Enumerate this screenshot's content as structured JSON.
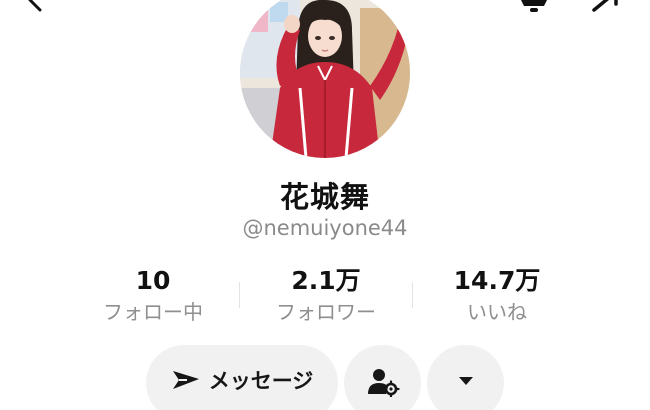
{
  "profile": {
    "display_name": "花城舞",
    "handle": "@nemuiyone44"
  },
  "stats": [
    {
      "value": "10",
      "label": "フォロー中"
    },
    {
      "value": "2.1万",
      "label": "フォロワー"
    },
    {
      "value": "14.7万",
      "label": "いいね"
    }
  ],
  "actions": {
    "message_label": "メッセージ"
  },
  "icons": {
    "back": "chevron-left-icon",
    "menu": "notification-icon",
    "share": "share-arrow-icon",
    "message": "send-icon",
    "follow_manage": "user-settings-icon",
    "more": "caret-down-icon"
  },
  "colors": {
    "text_primary": "#111111",
    "text_secondary": "#8a8a8a",
    "button_bg": "#f1f1f2"
  }
}
